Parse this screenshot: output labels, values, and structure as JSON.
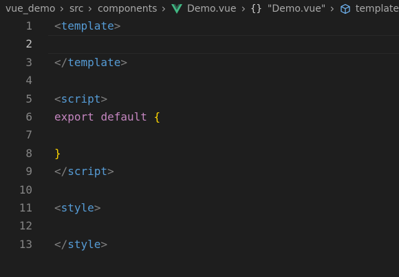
{
  "breadcrumb": {
    "items": [
      {
        "label": "vue_demo"
      },
      {
        "label": "src"
      },
      {
        "label": "components"
      },
      {
        "label": "Demo.vue"
      },
      {
        "label": "\"Demo.vue\""
      },
      {
        "label": "template"
      }
    ],
    "braces_glyph": "{}"
  },
  "editor": {
    "active_line": 2,
    "lines": [
      {
        "number": "1",
        "tokens": [
          {
            "text": "<",
            "kind": "punct"
          },
          {
            "text": "template",
            "kind": "tag"
          },
          {
            "text": ">",
            "kind": "punct"
          }
        ]
      },
      {
        "number": "2",
        "tokens": []
      },
      {
        "number": "3",
        "tokens": [
          {
            "text": "</",
            "kind": "punct"
          },
          {
            "text": "template",
            "kind": "tag"
          },
          {
            "text": ">",
            "kind": "punct"
          }
        ]
      },
      {
        "number": "4",
        "tokens": []
      },
      {
        "number": "5",
        "tokens": [
          {
            "text": "<",
            "kind": "punct"
          },
          {
            "text": "script",
            "kind": "tag"
          },
          {
            "text": ">",
            "kind": "punct"
          }
        ]
      },
      {
        "number": "6",
        "tokens": [
          {
            "text": "export",
            "kind": "kw"
          },
          {
            "text": " ",
            "kind": "plain"
          },
          {
            "text": "default",
            "kind": "kw"
          },
          {
            "text": " ",
            "kind": "plain"
          },
          {
            "text": "{",
            "kind": "brace"
          }
        ]
      },
      {
        "number": "7",
        "tokens": []
      },
      {
        "number": "8",
        "tokens": [
          {
            "text": "}",
            "kind": "brace"
          }
        ]
      },
      {
        "number": "9",
        "tokens": [
          {
            "text": "</",
            "kind": "punct"
          },
          {
            "text": "script",
            "kind": "tag"
          },
          {
            "text": ">",
            "kind": "punct"
          }
        ]
      },
      {
        "number": "10",
        "tokens": []
      },
      {
        "number": "11",
        "tokens": [
          {
            "text": "<",
            "kind": "punct"
          },
          {
            "text": "style",
            "kind": "tag"
          },
          {
            "text": ">",
            "kind": "punct"
          }
        ]
      },
      {
        "number": "12",
        "tokens": []
      },
      {
        "number": "13",
        "tokens": [
          {
            "text": "</",
            "kind": "punct"
          },
          {
            "text": "style",
            "kind": "tag"
          },
          {
            "text": ">",
            "kind": "punct"
          }
        ]
      }
    ]
  },
  "colors": {
    "background": "#1e1e1e",
    "tag": "#569cd6",
    "punctuation": "#808080",
    "keyword": "#c586c0",
    "brace": "#ffd700",
    "vue_logo": "#41b883",
    "symbol_icon": "#75beff"
  }
}
